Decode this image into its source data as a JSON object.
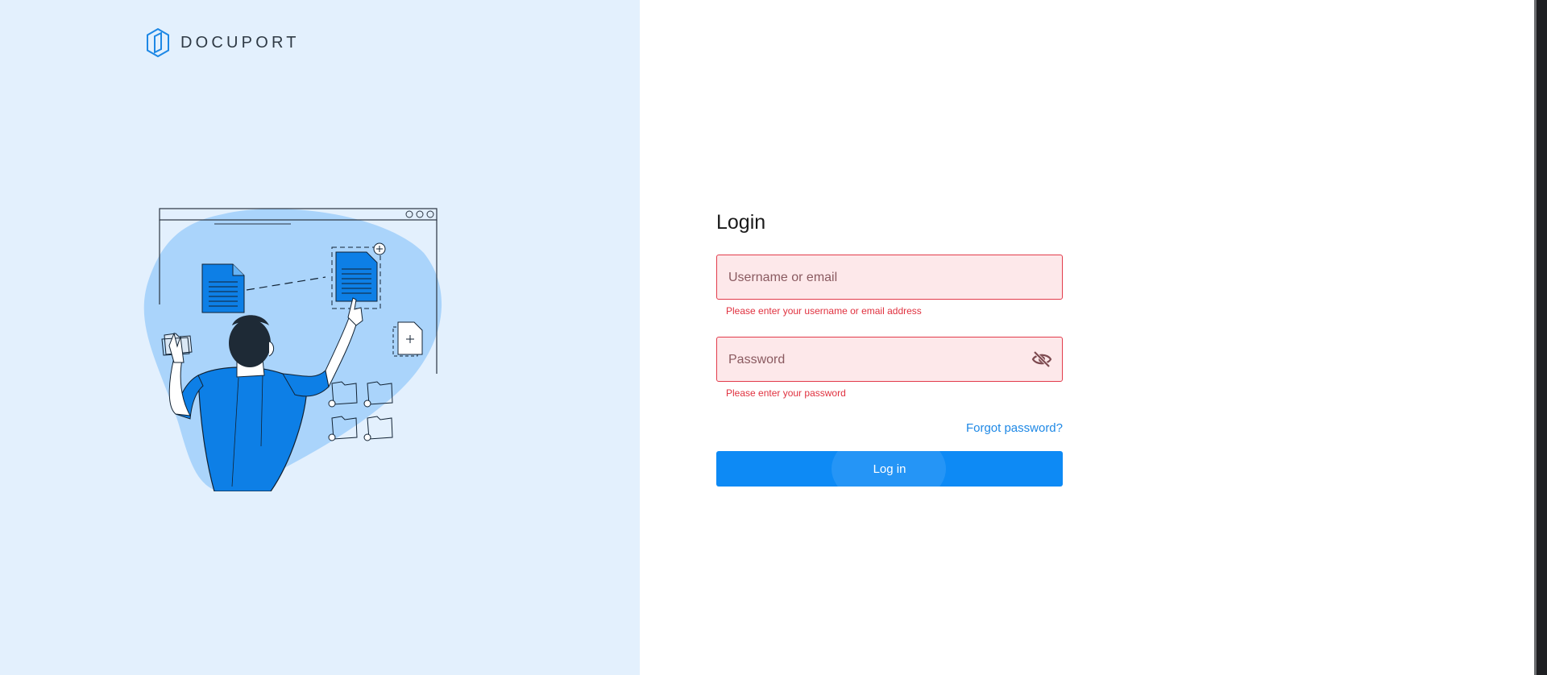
{
  "brand": {
    "name": "DOCUPORT",
    "logo_icon": "docuport-logo-icon",
    "accent_color": "#0d8af5"
  },
  "illustration": {
    "icon": "person-organizing-documents-illustration"
  },
  "login": {
    "title": "Login",
    "username": {
      "placeholder": "Username or email",
      "value": "",
      "error": "Please enter your username or email address"
    },
    "password": {
      "placeholder": "Password",
      "value": "",
      "error": "Please enter your password",
      "toggle_icon": "eye-off-icon"
    },
    "forgot_password": "Forgot password?",
    "submit": "Log in",
    "error_color": "#e0313f"
  }
}
